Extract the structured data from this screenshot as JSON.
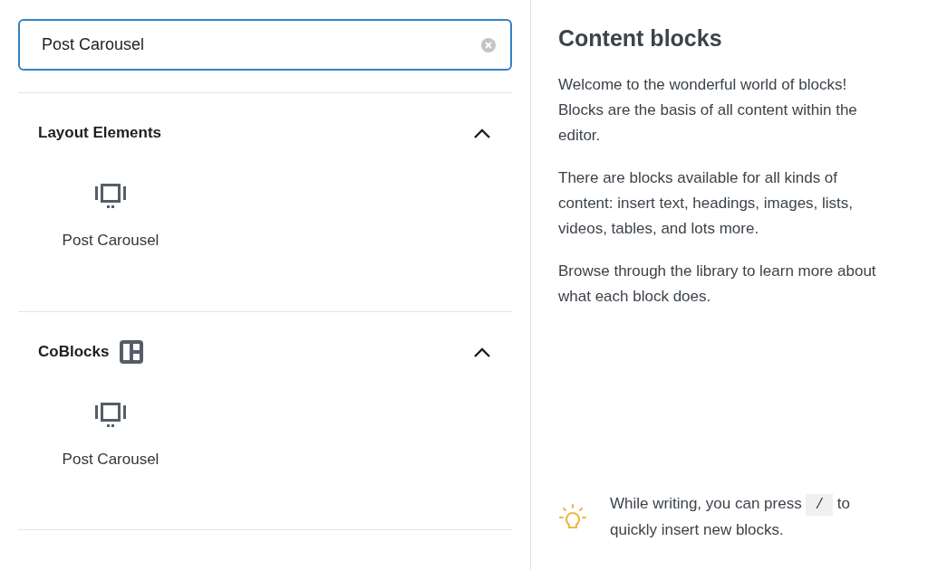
{
  "search": {
    "value": "Post Carousel"
  },
  "sections": [
    {
      "title": "Layout Elements",
      "kind": "category",
      "expanded": true,
      "items": [
        "Post Carousel"
      ]
    },
    {
      "title": "CoBlocks",
      "kind": "collection",
      "expanded": true,
      "items": [
        "Post Carousel"
      ]
    }
  ],
  "help": {
    "title": "Content blocks",
    "paragraphs": [
      "Welcome to the wonderful world of blocks! Blocks are the basis of all content within the editor.",
      "There are blocks available for all kinds of content: insert text, headings, images, lists, videos, tables, and lots more.",
      "Browse through the library to learn more about what each block does."
    ],
    "tip": {
      "before": "While writing, you can press",
      "key": "/",
      "after": "to",
      "next_line": "quickly insert new blocks."
    }
  }
}
